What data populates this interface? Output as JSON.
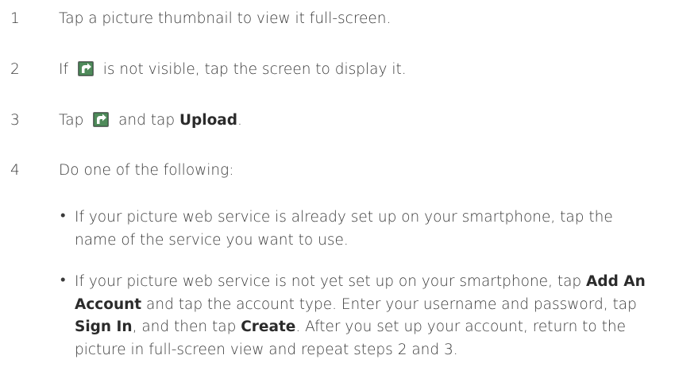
{
  "steps": [
    {
      "number": "1",
      "text": "Tap a picture thumbnail to view it full-screen."
    },
    {
      "number": "2",
      "text_before": "If ",
      "icon": "share-icon",
      "text_after": " is not visible, tap the screen to display it."
    },
    {
      "number": "3",
      "text_before": "Tap ",
      "icon": "share-icon",
      "text_mid": " and tap ",
      "bold": "Upload",
      "text_after": "."
    },
    {
      "number": "4",
      "text": "Do one of the following:"
    }
  ],
  "bullets": [
    {
      "symbol": "•",
      "text": "If your picture web service is already set up on your smartphone, tap the name of the service you want to use."
    },
    {
      "symbol": "•",
      "part1": "If your picture web service is not yet set up on your smartphone, tap ",
      "bold1": "Add An Account",
      "part2": " and tap the account type. Enter your username and password, tap ",
      "bold2": "Sign In",
      "part3": ", and then tap ",
      "bold3": "Create",
      "part4": ". After you set up your account, return to the picture in full-screen view and repeat steps 2 and 3."
    }
  ],
  "colors": {
    "text": "#3a3a3a",
    "icon_bg": "#3d6e4a",
    "icon_fg": "#ffffff"
  }
}
